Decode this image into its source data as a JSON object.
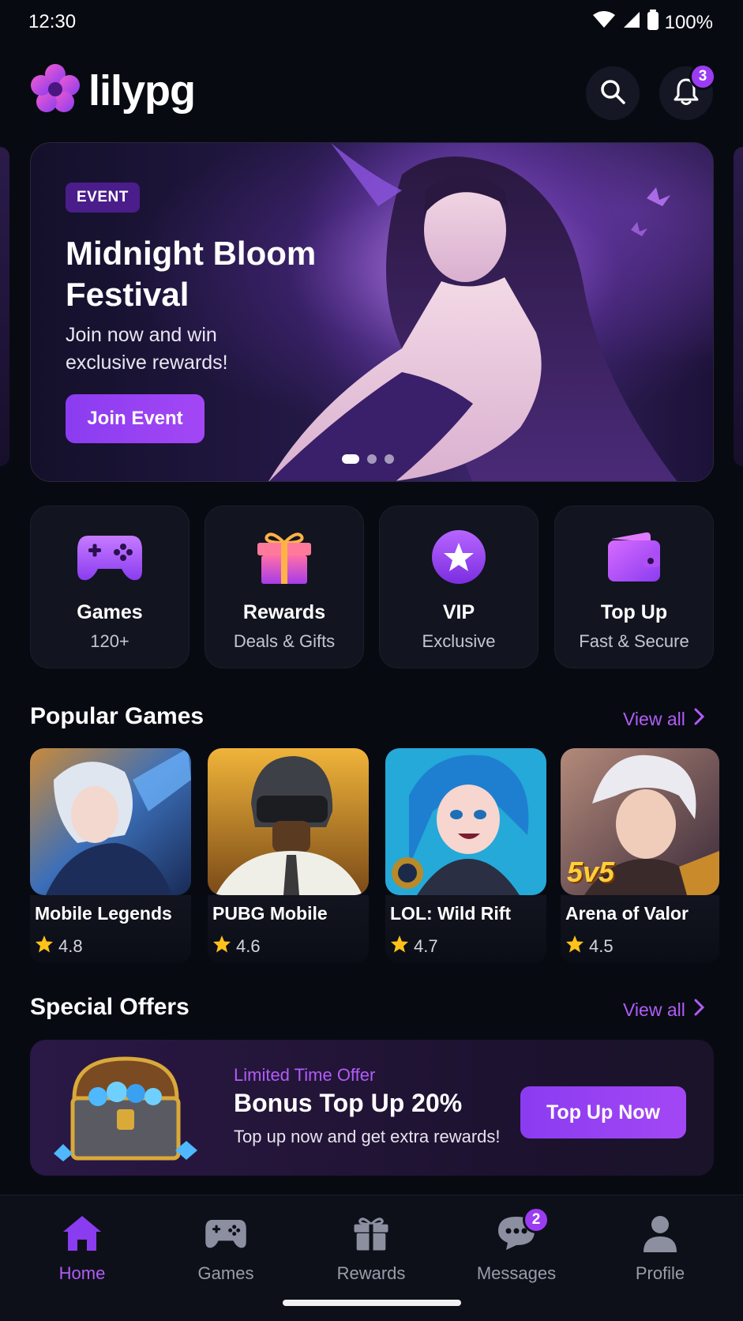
{
  "status_bar": {
    "time": "12:30",
    "battery": "100%"
  },
  "header": {
    "app_name": "lilypg",
    "notification_count": "3"
  },
  "banner": {
    "tag": "EVENT",
    "title": "Midnight Bloom Festival",
    "subtitle": "Join now and win exclusive rewards!",
    "button": "Join Event",
    "slides": 3,
    "active_slide": 1
  },
  "categories": [
    {
      "title": "Games",
      "sub": "120+",
      "icon": "gamepad-icon"
    },
    {
      "title": "Rewards",
      "sub": "Deals & Gifts",
      "icon": "gift-icon"
    },
    {
      "title": "VIP",
      "sub": "Exclusive",
      "icon": "star-badge-icon"
    },
    {
      "title": "Top Up",
      "sub": "Fast & Secure",
      "icon": "wallet-icon"
    }
  ],
  "popular": {
    "title": "Popular Games",
    "view_all": "View all",
    "games": [
      {
        "name": "Mobile Legends",
        "rating": "4.8"
      },
      {
        "name": "PUBG Mobile",
        "rating": "4.6"
      },
      {
        "name": "LOL: Wild Rift",
        "rating": "4.7"
      },
      {
        "name": "Arena of Valor",
        "rating": "4.5",
        "art_text": "5v5"
      }
    ]
  },
  "offers": {
    "title": "Special Offers",
    "view_all": "View all",
    "tag": "Limited Time Offer",
    "headline": "Bonus Top Up 20%",
    "sub": "Top up now and get extra rewards!",
    "button": "Top Up Now"
  },
  "nav": {
    "items": [
      {
        "label": "Home",
        "icon": "home-icon",
        "active": true
      },
      {
        "label": "Games",
        "icon": "gamepad-icon"
      },
      {
        "label": "Rewards",
        "icon": "gift-icon"
      },
      {
        "label": "Messages",
        "icon": "chat-icon",
        "badge": "2"
      },
      {
        "label": "Profile",
        "icon": "profile-icon"
      }
    ]
  },
  "colors": {
    "accent": "#9b3cf2",
    "accent_text": "#b15cf7",
    "background": "#080a12",
    "card": "#12141f"
  }
}
